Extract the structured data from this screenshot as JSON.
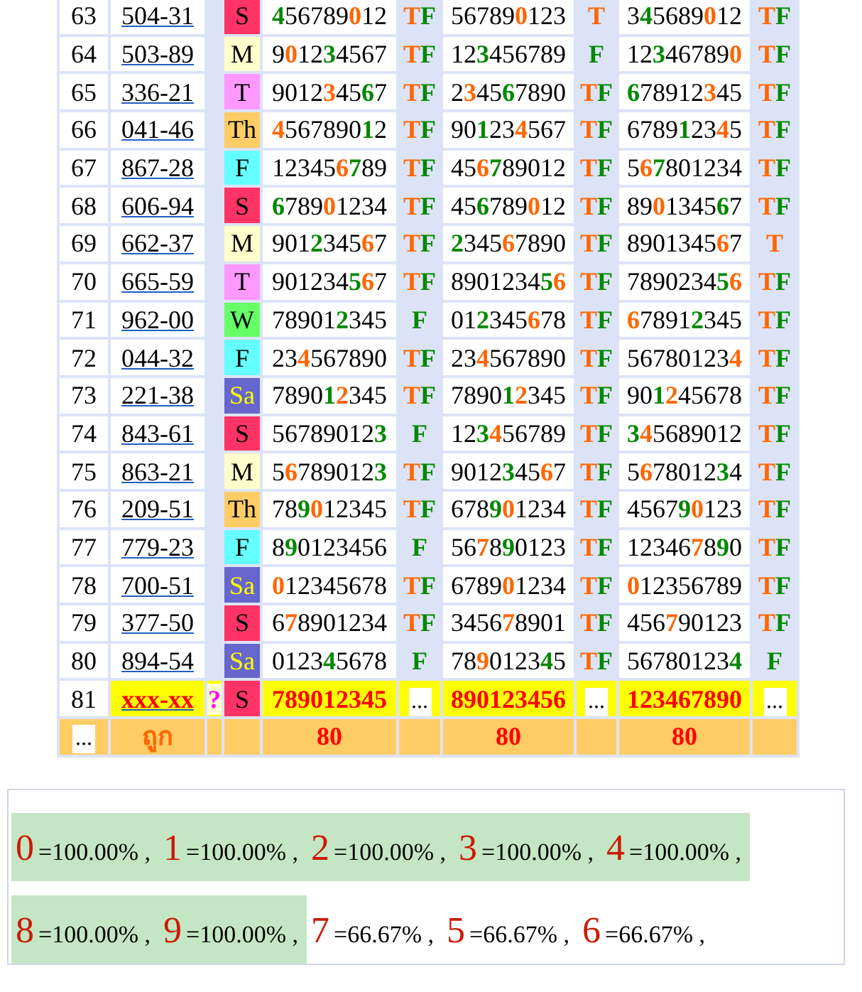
{
  "draws": [
    {
      "index": "63",
      "code": "504-31",
      "day": {
        "text": "S",
        "color": "#ff3366",
        "dark": false
      },
      "sets": [
        {
          "digits": [
            {
              "text": "4",
              "color": "#008800"
            },
            {
              "text": "56789",
              "color": "#000000"
            },
            {
              "text": "0",
              "color": "#ff6600"
            },
            {
              "text": "12",
              "color": "#000000"
            }
          ],
          "mark": [
            {
              "text": "T",
              "color": "#ff6600"
            },
            {
              "text": "F",
              "color": "#008800"
            }
          ]
        },
        {
          "digits": [
            {
              "text": "56789",
              "color": "#000000"
            },
            {
              "text": "0",
              "color": "#ff6600"
            },
            {
              "text": "123",
              "color": "#000000"
            }
          ],
          "mark": [
            {
              "text": "T",
              "color": "#ff6600"
            }
          ]
        },
        {
          "digits": [
            {
              "text": "3",
              "color": "#000000"
            },
            {
              "text": "4",
              "color": "#008800"
            },
            {
              "text": "5689",
              "color": "#000000"
            },
            {
              "text": "0",
              "color": "#ff6600"
            },
            {
              "text": "12",
              "color": "#000000"
            }
          ],
          "mark": [
            {
              "text": "T",
              "color": "#ff6600"
            },
            {
              "text": "F",
              "color": "#008800"
            }
          ]
        }
      ]
    },
    {
      "index": "64",
      "code": "503-89",
      "day": {
        "text": "M",
        "color": "#ffffcc",
        "dark": false
      },
      "sets": [
        {
          "digits": [
            {
              "text": "9",
              "color": "#000000"
            },
            {
              "text": "0",
              "color": "#ff6600"
            },
            {
              "text": "12",
              "color": "#000000"
            },
            {
              "text": "3",
              "color": "#008800"
            },
            {
              "text": "4567",
              "color": "#000000"
            }
          ],
          "mark": [
            {
              "text": "T",
              "color": "#ff6600"
            },
            {
              "text": "F",
              "color": "#008800"
            }
          ]
        },
        {
          "digits": [
            {
              "text": "12",
              "color": "#000000"
            },
            {
              "text": "3",
              "color": "#008800"
            },
            {
              "text": "456789",
              "color": "#000000"
            }
          ],
          "mark": [
            {
              "text": "F",
              "color": "#008800"
            }
          ]
        },
        {
          "digits": [
            {
              "text": "12",
              "color": "#000000"
            },
            {
              "text": "3",
              "color": "#008800"
            },
            {
              "text": "46789",
              "color": "#000000"
            },
            {
              "text": "0",
              "color": "#ff6600"
            }
          ],
          "mark": [
            {
              "text": "T",
              "color": "#ff6600"
            },
            {
              "text": "F",
              "color": "#008800"
            }
          ]
        }
      ]
    },
    {
      "index": "65",
      "code": "336-21",
      "day": {
        "text": "T",
        "color": "#ff99ff",
        "dark": false
      },
      "sets": [
        {
          "digits": [
            {
              "text": "9012",
              "color": "#000000"
            },
            {
              "text": "3",
              "color": "#ff6600"
            },
            {
              "text": "45",
              "color": "#000000"
            },
            {
              "text": "6",
              "color": "#008800"
            },
            {
              "text": "7",
              "color": "#000000"
            }
          ],
          "mark": [
            {
              "text": "T",
              "color": "#ff6600"
            },
            {
              "text": "F",
              "color": "#008800"
            }
          ]
        },
        {
          "digits": [
            {
              "text": "2",
              "color": "#000000"
            },
            {
              "text": "3",
              "color": "#ff6600"
            },
            {
              "text": "45",
              "color": "#000000"
            },
            {
              "text": "6",
              "color": "#008800"
            },
            {
              "text": "7890",
              "color": "#000000"
            }
          ],
          "mark": [
            {
              "text": "T",
              "color": "#ff6600"
            },
            {
              "text": "F",
              "color": "#008800"
            }
          ]
        },
        {
          "digits": [
            {
              "text": "6",
              "color": "#008800"
            },
            {
              "text": "78912",
              "color": "#000000"
            },
            {
              "text": "3",
              "color": "#ff6600"
            },
            {
              "text": "45",
              "color": "#000000"
            }
          ],
          "mark": [
            {
              "text": "T",
              "color": "#ff6600"
            },
            {
              "text": "F",
              "color": "#008800"
            }
          ]
        }
      ]
    },
    {
      "index": "66",
      "code": "041-46",
      "day": {
        "text": "Th",
        "color": "#ffcc66",
        "dark": false
      },
      "sets": [
        {
          "digits": [
            {
              "text": "4",
              "color": "#ff6600"
            },
            {
              "text": "567890",
              "color": "#000000"
            },
            {
              "text": "1",
              "color": "#008800"
            },
            {
              "text": "2",
              "color": "#000000"
            }
          ],
          "mark": [
            {
              "text": "T",
              "color": "#ff6600"
            },
            {
              "text": "F",
              "color": "#008800"
            }
          ]
        },
        {
          "digits": [
            {
              "text": "90",
              "color": "#000000"
            },
            {
              "text": "1",
              "color": "#008800"
            },
            {
              "text": "23",
              "color": "#000000"
            },
            {
              "text": "4",
              "color": "#ff6600"
            },
            {
              "text": "567",
              "color": "#000000"
            }
          ],
          "mark": [
            {
              "text": "T",
              "color": "#ff6600"
            },
            {
              "text": "F",
              "color": "#008800"
            }
          ]
        },
        {
          "digits": [
            {
              "text": "6789",
              "color": "#000000"
            },
            {
              "text": "1",
              "color": "#008800"
            },
            {
              "text": "23",
              "color": "#000000"
            },
            {
              "text": "4",
              "color": "#ff6600"
            },
            {
              "text": "5",
              "color": "#000000"
            }
          ],
          "mark": [
            {
              "text": "T",
              "color": "#ff6600"
            },
            {
              "text": "F",
              "color": "#008800"
            }
          ]
        }
      ]
    },
    {
      "index": "67",
      "code": "867-28",
      "day": {
        "text": "F",
        "color": "#66ffff",
        "dark": false
      },
      "sets": [
        {
          "digits": [
            {
              "text": "12345",
              "color": "#000000"
            },
            {
              "text": "6",
              "color": "#ff6600"
            },
            {
              "text": "7",
              "color": "#008800"
            },
            {
              "text": "89",
              "color": "#000000"
            }
          ],
          "mark": [
            {
              "text": "T",
              "color": "#ff6600"
            },
            {
              "text": "F",
              "color": "#008800"
            }
          ]
        },
        {
          "digits": [
            {
              "text": "45",
              "color": "#000000"
            },
            {
              "text": "6",
              "color": "#ff6600"
            },
            {
              "text": "7",
              "color": "#008800"
            },
            {
              "text": "89012",
              "color": "#000000"
            }
          ],
          "mark": [
            {
              "text": "T",
              "color": "#ff6600"
            },
            {
              "text": "F",
              "color": "#008800"
            }
          ]
        },
        {
          "digits": [
            {
              "text": "5",
              "color": "#000000"
            },
            {
              "text": "6",
              "color": "#ff6600"
            },
            {
              "text": "7",
              "color": "#008800"
            },
            {
              "text": "801234",
              "color": "#000000"
            }
          ],
          "mark": [
            {
              "text": "T",
              "color": "#ff6600"
            },
            {
              "text": "F",
              "color": "#008800"
            }
          ]
        }
      ]
    },
    {
      "index": "68",
      "code": "606-94",
      "day": {
        "text": "S",
        "color": "#ff3366",
        "dark": false
      },
      "sets": [
        {
          "digits": [
            {
              "text": "6",
              "color": "#008800"
            },
            {
              "text": "789",
              "color": "#000000"
            },
            {
              "text": "0",
              "color": "#ff6600"
            },
            {
              "text": "1234",
              "color": "#000000"
            }
          ],
          "mark": [
            {
              "text": "T",
              "color": "#ff6600"
            },
            {
              "text": "F",
              "color": "#008800"
            }
          ]
        },
        {
          "digits": [
            {
              "text": "45",
              "color": "#000000"
            },
            {
              "text": "6",
              "color": "#008800"
            },
            {
              "text": "789",
              "color": "#000000"
            },
            {
              "text": "0",
              "color": "#ff6600"
            },
            {
              "text": "12",
              "color": "#000000"
            }
          ],
          "mark": [
            {
              "text": "T",
              "color": "#ff6600"
            },
            {
              "text": "F",
              "color": "#008800"
            }
          ]
        },
        {
          "digits": [
            {
              "text": "89",
              "color": "#000000"
            },
            {
              "text": "0",
              "color": "#ff6600"
            },
            {
              "text": "1345",
              "color": "#000000"
            },
            {
              "text": "6",
              "color": "#008800"
            },
            {
              "text": "7",
              "color": "#000000"
            }
          ],
          "mark": [
            {
              "text": "T",
              "color": "#ff6600"
            },
            {
              "text": "F",
              "color": "#008800"
            }
          ]
        }
      ]
    },
    {
      "index": "69",
      "code": "662-37",
      "day": {
        "text": "M",
        "color": "#ffffcc",
        "dark": false
      },
      "sets": [
        {
          "digits": [
            {
              "text": "901",
              "color": "#000000"
            },
            {
              "text": "2",
              "color": "#008800"
            },
            {
              "text": "345",
              "color": "#000000"
            },
            {
              "text": "6",
              "color": "#ff6600"
            },
            {
              "text": "7",
              "color": "#000000"
            }
          ],
          "mark": [
            {
              "text": "T",
              "color": "#ff6600"
            },
            {
              "text": "F",
              "color": "#008800"
            }
          ]
        },
        {
          "digits": [
            {
              "text": "2",
              "color": "#008800"
            },
            {
              "text": "345",
              "color": "#000000"
            },
            {
              "text": "6",
              "color": "#ff6600"
            },
            {
              "text": "7890",
              "color": "#000000"
            }
          ],
          "mark": [
            {
              "text": "T",
              "color": "#ff6600"
            },
            {
              "text": "F",
              "color": "#008800"
            }
          ]
        },
        {
          "digits": [
            {
              "text": "890134",
              "color": "#000000"
            },
            {
              "text": "5",
              "color": "#000000"
            },
            {
              "text": "6",
              "color": "#ff6600"
            },
            {
              "text": "7",
              "color": "#000000"
            }
          ],
          "mark": [
            {
              "text": "T",
              "color": "#ff6600"
            }
          ]
        }
      ]
    },
    {
      "index": "70",
      "code": "665-59",
      "day": {
        "text": "T",
        "color": "#ff99ff",
        "dark": false
      },
      "sets": [
        {
          "digits": [
            {
              "text": "901234",
              "color": "#000000"
            },
            {
              "text": "5",
              "color": "#008800"
            },
            {
              "text": "6",
              "color": "#ff6600"
            },
            {
              "text": "7",
              "color": "#000000"
            }
          ],
          "mark": [
            {
              "text": "T",
              "color": "#ff6600"
            },
            {
              "text": "F",
              "color": "#008800"
            }
          ]
        },
        {
          "digits": [
            {
              "text": "8901234",
              "color": "#000000"
            },
            {
              "text": "5",
              "color": "#008800"
            },
            {
              "text": "6",
              "color": "#ff6600"
            }
          ],
          "mark": [
            {
              "text": "T",
              "color": "#ff6600"
            },
            {
              "text": "F",
              "color": "#008800"
            }
          ]
        },
        {
          "digits": [
            {
              "text": "7890234",
              "color": "#000000"
            },
            {
              "text": "5",
              "color": "#008800"
            },
            {
              "text": "6",
              "color": "#ff6600"
            }
          ],
          "mark": [
            {
              "text": "T",
              "color": "#ff6600"
            },
            {
              "text": "F",
              "color": "#008800"
            }
          ]
        }
      ]
    },
    {
      "index": "71",
      "code": "962-00",
      "day": {
        "text": "W",
        "color": "#66ff66",
        "dark": false
      },
      "sets": [
        {
          "digits": [
            {
              "text": "78901",
              "color": "#000000"
            },
            {
              "text": "2",
              "color": "#008800"
            },
            {
              "text": "345",
              "color": "#000000"
            }
          ],
          "mark": [
            {
              "text": "F",
              "color": "#008800"
            }
          ]
        },
        {
          "digits": [
            {
              "text": "01",
              "color": "#000000"
            },
            {
              "text": "2",
              "color": "#008800"
            },
            {
              "text": "345",
              "color": "#000000"
            },
            {
              "text": "6",
              "color": "#ff6600"
            },
            {
              "text": "78",
              "color": "#000000"
            }
          ],
          "mark": [
            {
              "text": "T",
              "color": "#ff6600"
            },
            {
              "text": "F",
              "color": "#008800"
            }
          ]
        },
        {
          "digits": [
            {
              "text": "6",
              "color": "#ff6600"
            },
            {
              "text": "7891",
              "color": "#000000"
            },
            {
              "text": "2",
              "color": "#008800"
            },
            {
              "text": "345",
              "color": "#000000"
            }
          ],
          "mark": [
            {
              "text": "T",
              "color": "#ff6600"
            },
            {
              "text": "F",
              "color": "#008800"
            }
          ]
        }
      ]
    },
    {
      "index": "72",
      "code": "044-32",
      "day": {
        "text": "F",
        "color": "#66ffff",
        "dark": false
      },
      "sets": [
        {
          "digits": [
            {
              "text": "23",
              "color": "#000000"
            },
            {
              "text": "4",
              "color": "#ff6600"
            },
            {
              "text": "567890",
              "color": "#000000"
            }
          ],
          "mark": [
            {
              "text": "T",
              "color": "#ff6600"
            },
            {
              "text": "F",
              "color": "#008800"
            }
          ]
        },
        {
          "digits": [
            {
              "text": "23",
              "color": "#000000"
            },
            {
              "text": "4",
              "color": "#ff6600"
            },
            {
              "text": "567890",
              "color": "#000000"
            }
          ],
          "mark": [
            {
              "text": "T",
              "color": "#ff6600"
            },
            {
              "text": "F",
              "color": "#008800"
            }
          ]
        },
        {
          "digits": [
            {
              "text": "56780123",
              "color": "#000000"
            },
            {
              "text": "4",
              "color": "#ff6600"
            }
          ],
          "mark": [
            {
              "text": "T",
              "color": "#ff6600"
            },
            {
              "text": "F",
              "color": "#008800"
            }
          ]
        }
      ]
    },
    {
      "index": "73",
      "code": "221-38",
      "day": {
        "text": "Sa",
        "color": "#6666cc",
        "dark": true
      },
      "sets": [
        {
          "digits": [
            {
              "text": "7890",
              "color": "#000000"
            },
            {
              "text": "1",
              "color": "#008800"
            },
            {
              "text": "2",
              "color": "#ff6600"
            },
            {
              "text": "345",
              "color": "#000000"
            }
          ],
          "mark": [
            {
              "text": "T",
              "color": "#ff6600"
            },
            {
              "text": "F",
              "color": "#008800"
            }
          ]
        },
        {
          "digits": [
            {
              "text": "7890",
              "color": "#000000"
            },
            {
              "text": "1",
              "color": "#008800"
            },
            {
              "text": "2",
              "color": "#ff6600"
            },
            {
              "text": "345",
              "color": "#000000"
            }
          ],
          "mark": [
            {
              "text": "T",
              "color": "#ff6600"
            },
            {
              "text": "F",
              "color": "#008800"
            }
          ]
        },
        {
          "digits": [
            {
              "text": "90",
              "color": "#000000"
            },
            {
              "text": "1",
              "color": "#008800"
            },
            {
              "text": "2",
              "color": "#ff6600"
            },
            {
              "text": "45678",
              "color": "#000000"
            }
          ],
          "mark": [
            {
              "text": "T",
              "color": "#ff6600"
            },
            {
              "text": "F",
              "color": "#008800"
            }
          ]
        }
      ]
    },
    {
      "index": "74",
      "code": "843-61",
      "day": {
        "text": "S",
        "color": "#ff3366",
        "dark": false
      },
      "sets": [
        {
          "digits": [
            {
              "text": "56789012",
              "color": "#000000"
            },
            {
              "text": "3",
              "color": "#008800"
            }
          ],
          "mark": [
            {
              "text": "F",
              "color": "#008800"
            }
          ]
        },
        {
          "digits": [
            {
              "text": "12",
              "color": "#000000"
            },
            {
              "text": "3",
              "color": "#008800"
            },
            {
              "text": "4",
              "color": "#ff6600"
            },
            {
              "text": "56789",
              "color": "#000000"
            }
          ],
          "mark": [
            {
              "text": "T",
              "color": "#ff6600"
            },
            {
              "text": "F",
              "color": "#008800"
            }
          ]
        },
        {
          "digits": [
            {
              "text": "3",
              "color": "#008800"
            },
            {
              "text": "4",
              "color": "#ff6600"
            },
            {
              "text": "5689012",
              "color": "#000000"
            }
          ],
          "mark": [
            {
              "text": "T",
              "color": "#ff6600"
            },
            {
              "text": "F",
              "color": "#008800"
            }
          ]
        }
      ]
    },
    {
      "index": "75",
      "code": "863-21",
      "day": {
        "text": "M",
        "color": "#ffffcc",
        "dark": false
      },
      "sets": [
        {
          "digits": [
            {
              "text": "5",
              "color": "#000000"
            },
            {
              "text": "6",
              "color": "#ff6600"
            },
            {
              "text": "789012",
              "color": "#000000"
            },
            {
              "text": "3",
              "color": "#008800"
            }
          ],
          "mark": [
            {
              "text": "T",
              "color": "#ff6600"
            },
            {
              "text": "F",
              "color": "#008800"
            }
          ]
        },
        {
          "digits": [
            {
              "text": "9012",
              "color": "#000000"
            },
            {
              "text": "3",
              "color": "#008800"
            },
            {
              "text": "45",
              "color": "#000000"
            },
            {
              "text": "6",
              "color": "#ff6600"
            },
            {
              "text": "7",
              "color": "#000000"
            }
          ],
          "mark": [
            {
              "text": "T",
              "color": "#ff6600"
            },
            {
              "text": "F",
              "color": "#008800"
            }
          ]
        },
        {
          "digits": [
            {
              "text": "5",
              "color": "#000000"
            },
            {
              "text": "6",
              "color": "#ff6600"
            },
            {
              "text": "78012",
              "color": "#000000"
            },
            {
              "text": "3",
              "color": "#008800"
            },
            {
              "text": "4",
              "color": "#000000"
            }
          ],
          "mark": [
            {
              "text": "T",
              "color": "#ff6600"
            },
            {
              "text": "F",
              "color": "#008800"
            }
          ]
        }
      ]
    },
    {
      "index": "76",
      "code": "209-51",
      "day": {
        "text": "Th",
        "color": "#ffcc66",
        "dark": false
      },
      "sets": [
        {
          "digits": [
            {
              "text": "78",
              "color": "#000000"
            },
            {
              "text": "9",
              "color": "#008800"
            },
            {
              "text": "0",
              "color": "#ff6600"
            },
            {
              "text": "12345",
              "color": "#000000"
            }
          ],
          "mark": [
            {
              "text": "T",
              "color": "#ff6600"
            },
            {
              "text": "F",
              "color": "#008800"
            }
          ]
        },
        {
          "digits": [
            {
              "text": "678",
              "color": "#000000"
            },
            {
              "text": "9",
              "color": "#008800"
            },
            {
              "text": "0",
              "color": "#ff6600"
            },
            {
              "text": "1234",
              "color": "#000000"
            }
          ],
          "mark": [
            {
              "text": "T",
              "color": "#ff6600"
            },
            {
              "text": "F",
              "color": "#008800"
            }
          ]
        },
        {
          "digits": [
            {
              "text": "4567",
              "color": "#000000"
            },
            {
              "text": "9",
              "color": "#008800"
            },
            {
              "text": "0",
              "color": "#ff6600"
            },
            {
              "text": "123",
              "color": "#000000"
            }
          ],
          "mark": [
            {
              "text": "T",
              "color": "#ff6600"
            },
            {
              "text": "F",
              "color": "#008800"
            }
          ]
        }
      ]
    },
    {
      "index": "77",
      "code": "779-23",
      "day": {
        "text": "F",
        "color": "#66ffff",
        "dark": false
      },
      "sets": [
        {
          "digits": [
            {
              "text": "8",
              "color": "#000000"
            },
            {
              "text": "9",
              "color": "#008800"
            },
            {
              "text": "0123456",
              "color": "#000000"
            }
          ],
          "mark": [
            {
              "text": "F",
              "color": "#008800"
            }
          ]
        },
        {
          "digits": [
            {
              "text": "56",
              "color": "#000000"
            },
            {
              "text": "7",
              "color": "#ff6600"
            },
            {
              "text": "8",
              "color": "#000000"
            },
            {
              "text": "9",
              "color": "#008800"
            },
            {
              "text": "0123",
              "color": "#000000"
            }
          ],
          "mark": [
            {
              "text": "T",
              "color": "#ff6600"
            },
            {
              "text": "F",
              "color": "#008800"
            }
          ]
        },
        {
          "digits": [
            {
              "text": "12346",
              "color": "#000000"
            },
            {
              "text": "7",
              "color": "#ff6600"
            },
            {
              "text": "8",
              "color": "#000000"
            },
            {
              "text": "9",
              "color": "#008800"
            },
            {
              "text": "0",
              "color": "#000000"
            }
          ],
          "mark": [
            {
              "text": "T",
              "color": "#ff6600"
            },
            {
              "text": "F",
              "color": "#008800"
            }
          ]
        }
      ]
    },
    {
      "index": "78",
      "code": "700-51",
      "day": {
        "text": "Sa",
        "color": "#6666cc",
        "dark": true
      },
      "sets": [
        {
          "digits": [
            {
              "text": "0",
              "color": "#ff6600"
            },
            {
              "text": "12345678",
              "color": "#000000"
            }
          ],
          "mark": [
            {
              "text": "T",
              "color": "#ff6600"
            },
            {
              "text": "F",
              "color": "#008800"
            }
          ]
        },
        {
          "digits": [
            {
              "text": "6789",
              "color": "#000000"
            },
            {
              "text": "0",
              "color": "#ff6600"
            },
            {
              "text": "1234",
              "color": "#000000"
            }
          ],
          "mark": [
            {
              "text": "T",
              "color": "#ff6600"
            },
            {
              "text": "F",
              "color": "#008800"
            }
          ]
        },
        {
          "digits": [
            {
              "text": "0",
              "color": "#ff6600"
            },
            {
              "text": "12356789",
              "color": "#000000"
            }
          ],
          "mark": [
            {
              "text": "T",
              "color": "#ff6600"
            },
            {
              "text": "F",
              "color": "#008800"
            }
          ]
        }
      ]
    },
    {
      "index": "79",
      "code": "377-50",
      "day": {
        "text": "S",
        "color": "#ff3366",
        "dark": false
      },
      "sets": [
        {
          "digits": [
            {
              "text": "6",
              "color": "#000000"
            },
            {
              "text": "7",
              "color": "#ff6600"
            },
            {
              "text": "8901234",
              "color": "#000000"
            }
          ],
          "mark": [
            {
              "text": "T",
              "color": "#ff6600"
            },
            {
              "text": "F",
              "color": "#008800"
            }
          ]
        },
        {
          "digits": [
            {
              "text": "3456",
              "color": "#000000"
            },
            {
              "text": "7",
              "color": "#ff6600"
            },
            {
              "text": "8901",
              "color": "#000000"
            }
          ],
          "mark": [
            {
              "text": "T",
              "color": "#ff6600"
            },
            {
              "text": "F",
              "color": "#008800"
            }
          ]
        },
        {
          "digits": [
            {
              "text": "456",
              "color": "#000000"
            },
            {
              "text": "7",
              "color": "#ff6600"
            },
            {
              "text": "90123",
              "color": "#000000"
            }
          ],
          "mark": [
            {
              "text": "T",
              "color": "#ff6600"
            },
            {
              "text": "F",
              "color": "#008800"
            }
          ]
        }
      ]
    },
    {
      "index": "80",
      "code": "894-54",
      "day": {
        "text": "Sa",
        "color": "#6666cc",
        "dark": true
      },
      "sets": [
        {
          "digits": [
            {
              "text": "0123",
              "color": "#000000"
            },
            {
              "text": "4",
              "color": "#008800"
            },
            {
              "text": "5678",
              "color": "#000000"
            }
          ],
          "mark": [
            {
              "text": "F",
              "color": "#008800"
            }
          ]
        },
        {
          "digits": [
            {
              "text": "78",
              "color": "#000000"
            },
            {
              "text": "9",
              "color": "#ff6600"
            },
            {
              "text": "0123",
              "color": "#000000"
            },
            {
              "text": "4",
              "color": "#008800"
            },
            {
              "text": "5",
              "color": "#000000"
            }
          ],
          "mark": [
            {
              "text": "T",
              "color": "#ff6600"
            },
            {
              "text": "F",
              "color": "#008800"
            }
          ]
        },
        {
          "digits": [
            {
              "text": "56780123",
              "color": "#000000"
            },
            {
              "text": "4",
              "color": "#008800"
            }
          ],
          "mark": [
            {
              "text": "F",
              "color": "#008800"
            }
          ]
        }
      ]
    }
  ],
  "pending": {
    "index": "81",
    "code": "xxx-xx",
    "flag": "?",
    "day": {
      "text": "S",
      "color": "#ff3366",
      "dark": false
    },
    "sets": [
      {
        "digits": "789012345",
        "mark": "..."
      },
      {
        "digits": "890123456",
        "mark": "..."
      },
      {
        "digits": "123467890",
        "mark": "..."
      }
    ]
  },
  "summary": {
    "index": "...",
    "label": "ถูก",
    "counts": [
      "80",
      "80",
      "80"
    ]
  },
  "results": [
    {
      "digit": "0",
      "value": "=100.00% ,",
      "hit": true
    },
    {
      "digit": "1",
      "value": "=100.00% ,",
      "hit": true
    },
    {
      "digit": "2",
      "value": "=100.00% ,",
      "hit": true
    },
    {
      "digit": "3",
      "value": "=100.00% ,",
      "hit": true
    },
    {
      "digit": "4",
      "value": "=100.00% ,",
      "hit": true
    },
    {
      "digit": "8",
      "value": "=100.00% ,",
      "hit": true
    },
    {
      "digit": "9",
      "value": "=100.00% ,",
      "hit": true
    },
    {
      "digit": "7",
      "value": "=66.67% ,",
      "hit": false
    },
    {
      "digit": "5",
      "value": "=66.67% ,",
      "hit": false
    },
    {
      "digit": "6",
      "value": "=66.67% ,",
      "hit": false
    }
  ]
}
